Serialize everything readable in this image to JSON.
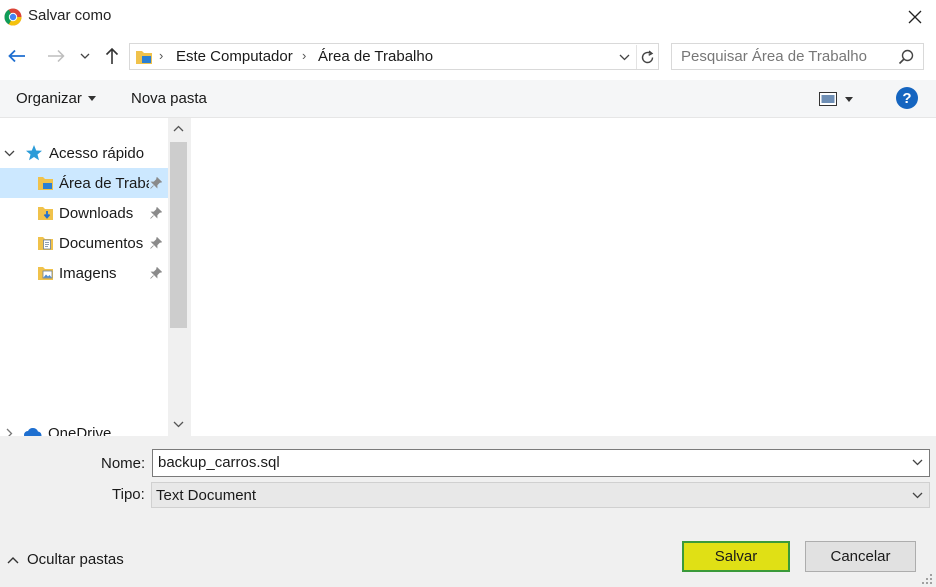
{
  "window": {
    "title": "Salvar como",
    "app_icon": "chrome-icon",
    "close_icon": "close-icon"
  },
  "address": {
    "crumbs": [
      "Este Computador",
      "Área de Trabalho"
    ],
    "search_placeholder": "Pesquisar Área de Trabalho"
  },
  "toolbar": {
    "organize_label": "Organizar",
    "new_folder_label": "Nova pasta",
    "help_label": "?"
  },
  "nav": {
    "quick_access_label": "Acesso rápido",
    "items": [
      {
        "label": "Área de Traba",
        "icon": "desktop-folder-icon",
        "selected": true
      },
      {
        "label": "Downloads",
        "icon": "downloads-folder-icon",
        "selected": false
      },
      {
        "label": "Documentos",
        "icon": "documents-folder-icon",
        "selected": false
      },
      {
        "label": "Imagens",
        "icon": "pictures-folder-icon",
        "selected": false
      }
    ],
    "onedrive_label": "OneDrive"
  },
  "form": {
    "name_label": "Nome:",
    "name_value": "backup_carros.sql",
    "type_label": "Tipo:",
    "type_value": "Text Document"
  },
  "footer": {
    "hide_folders_label": "Ocultar pastas",
    "save_label": "Salvar",
    "cancel_label": "Cancelar"
  },
  "colors": {
    "accent": "#1565c0",
    "selected_row": "#cce8ff",
    "save_highlight": "#e0e015"
  }
}
